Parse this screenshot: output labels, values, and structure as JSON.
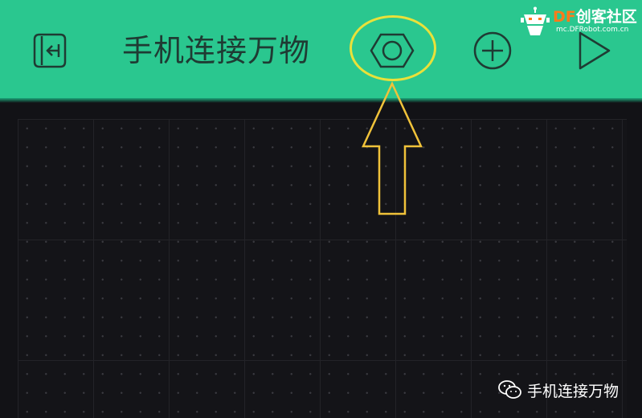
{
  "app": {
    "title": "手机连接万物"
  },
  "toolbar": {
    "back_icon": "exit-door-icon",
    "settings_icon": "hexagon-nut-settings-icon",
    "add_icon": "plus-circle-icon",
    "play_icon": "play-triangle-icon"
  },
  "logo": {
    "brand_accent": "DF",
    "brand_rest": "创客社区",
    "subtitle": "mc.DFRobot.com.cn"
  },
  "annotation": {
    "ring_color": "#e9e13a",
    "arrow_color": "#f0c23a"
  },
  "watermark": {
    "text": "手机连接万物",
    "icon": "wechat-icon"
  },
  "colors": {
    "toolbar_bg": "#2ac78f",
    "icon_color": "#1f3b33",
    "canvas_bg": "#141418"
  }
}
